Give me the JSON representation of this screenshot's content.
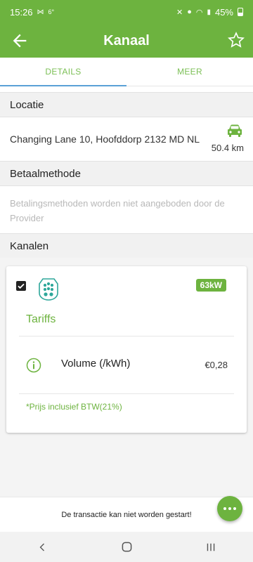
{
  "status_bar": {
    "time": "15:26",
    "temp": "6°",
    "battery": "45%"
  },
  "app_bar": {
    "title": "Kanaal"
  },
  "tabs": [
    {
      "label": "DETAILS"
    },
    {
      "label": "MEER"
    }
  ],
  "sections": {
    "location": {
      "header": "Locatie",
      "address": "Changing Lane 10, Hoofddorp 2132 MD NL",
      "distance": "50.4 km"
    },
    "payment": {
      "header": "Betaalmethode",
      "message": "Betalingsmethoden worden niet aangeboden door de Provider"
    },
    "channels": {
      "header": "Kanalen"
    }
  },
  "channel_card": {
    "power_badge": "63kW",
    "tariffs_title": "Tariffs",
    "tariff": {
      "label": "Volume (/kWh)",
      "price": "€0,28"
    },
    "footnote": "*Prijs inclusief BTW(21%)"
  },
  "bottom_message": "De transactie kan niet worden gestart!",
  "colors": {
    "brand_green": "#6db33f",
    "tab_indicator": "#5aa1d6"
  }
}
